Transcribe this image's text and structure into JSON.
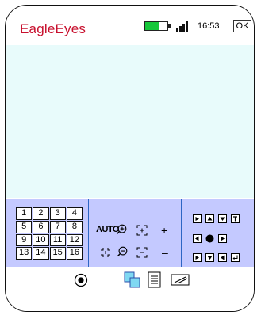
{
  "app": {
    "title": "EagleEyes"
  },
  "status_bar": {
    "battery_level": 0.6,
    "battery_color": "#16c73a",
    "time": "16:53",
    "ok_label": "OK"
  },
  "channels": [
    "1",
    "2",
    "3",
    "4",
    "5",
    "6",
    "7",
    "8",
    "9",
    "10",
    "11",
    "12",
    "13",
    "14",
    "15",
    "16"
  ],
  "ptz": {
    "auto_label": "AUTO",
    "plus_label": "+",
    "minus_label": "–"
  },
  "colors": {
    "brand": "#c8102e",
    "video_bg": "#e8fbfb",
    "control_bg": "#c4c9ff",
    "divider": "#2d66c4"
  },
  "icons": {
    "zoom_in": "zoom-in-icon",
    "zoom_out": "zoom-out-icon",
    "focus_near": "focus-near-icon",
    "focus_far": "focus-far-icon",
    "iris_open": "iris-open-icon",
    "iris_close": "iris-close-icon",
    "record": "record-icon",
    "multi_view": "multi-view-icon",
    "list": "list-icon",
    "snapshot": "snapshot-icon"
  }
}
